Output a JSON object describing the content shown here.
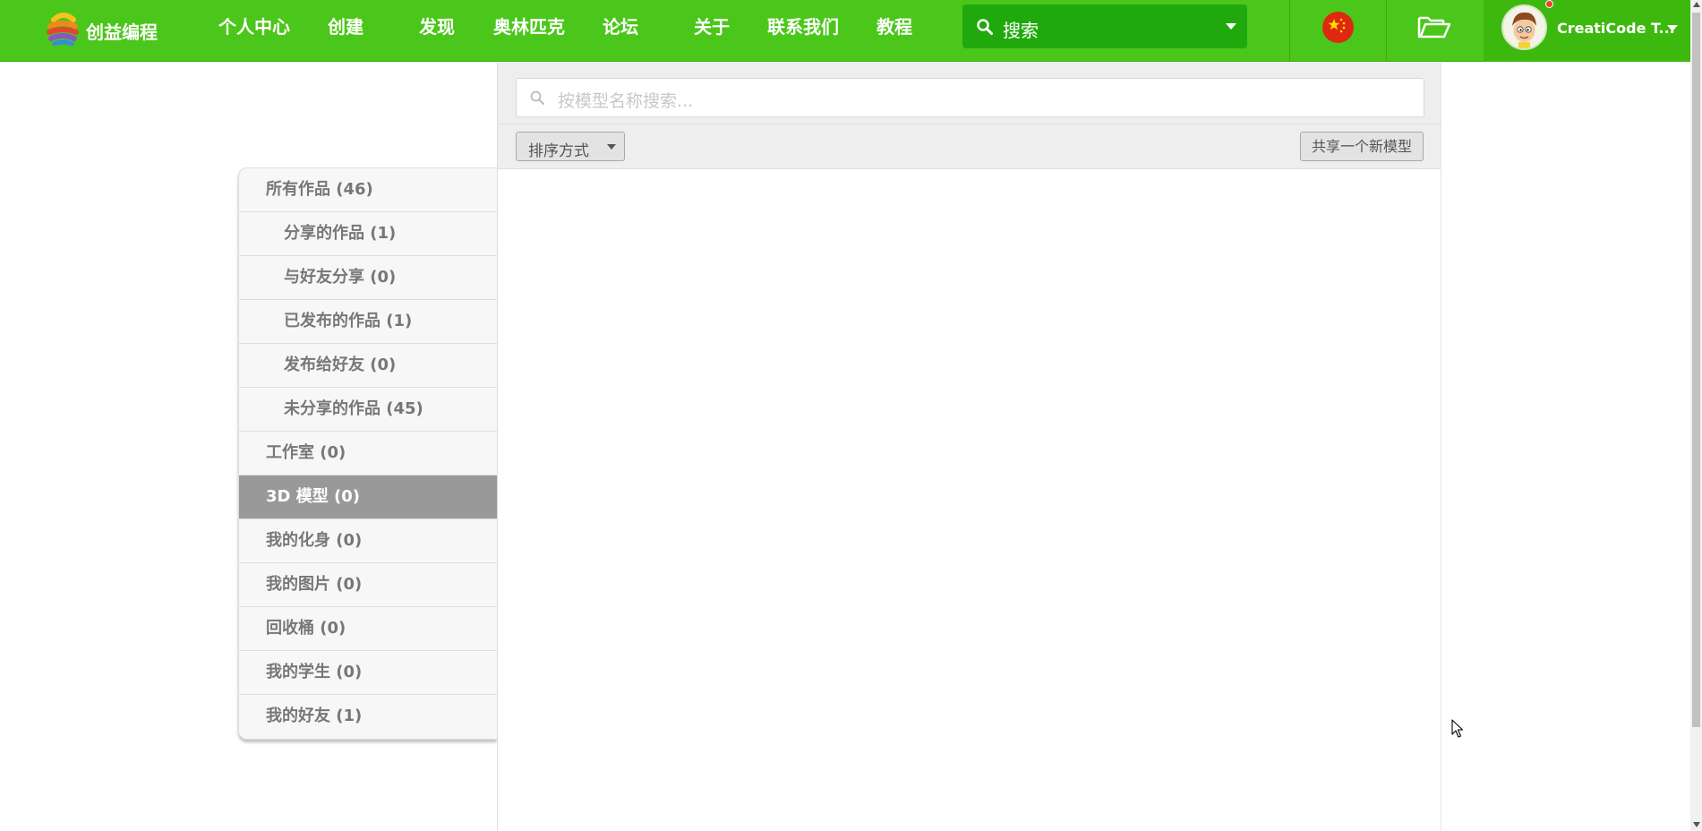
{
  "brand": {
    "name": "创益编程",
    "logo_icon": "rainbow-globe-logo"
  },
  "nav": {
    "items": [
      {
        "label": "个人中心"
      },
      {
        "label": "创建"
      },
      {
        "label": "发现"
      },
      {
        "label": "奥林匹克"
      },
      {
        "label": "论坛"
      },
      {
        "label": "关于"
      },
      {
        "label": "联系我们"
      },
      {
        "label": "教程"
      }
    ],
    "search": {
      "placeholder": "搜索"
    },
    "language_icon": "china-flag-icon",
    "folder_icon": "folder-open-icon",
    "user": {
      "name": "CreatiCode T...",
      "avatar_icon": "cartoon-boy-avatar"
    }
  },
  "sidebar": {
    "items": [
      {
        "label": "所有作品 (46)"
      },
      {
        "label": "分享的作品 (1)"
      },
      {
        "label": "与好友分享 (0)"
      },
      {
        "label": "已发布的作品 (1)"
      },
      {
        "label": "发布给好友 (0)"
      },
      {
        "label": "未分享的作品 (45)"
      },
      {
        "label": "工作室 (0)"
      },
      {
        "label": "3D 模型 (0)"
      },
      {
        "label": "我的化身 (0)"
      },
      {
        "label": "我的图片 (0)"
      },
      {
        "label": "回收桶 (0)"
      },
      {
        "label": "我的学生 (0)"
      },
      {
        "label": "我的好友 (1)"
      }
    ],
    "active_index": 7
  },
  "main": {
    "model_search": {
      "placeholder": "按模型名称搜索..."
    },
    "sort_label": "排序方式",
    "share_button": "共享一个新模型"
  },
  "colors": {
    "nav_bg": "#4bc61a",
    "search_bg": "#20a90d",
    "active_item": "#999999"
  }
}
